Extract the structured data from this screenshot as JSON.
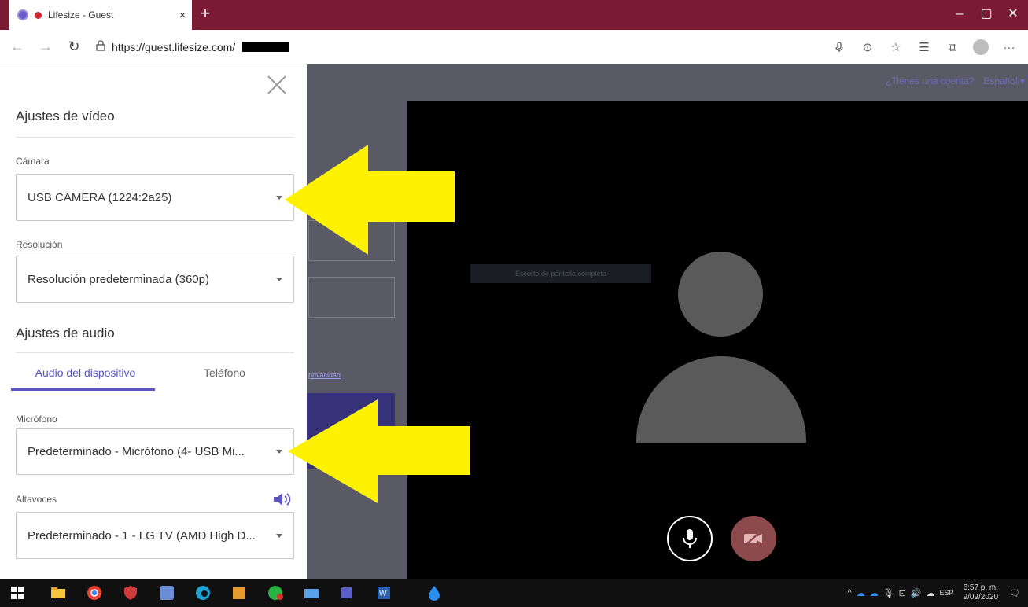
{
  "browser": {
    "tab_title": "Lifesize - Guest",
    "tab_close": "×",
    "new_tab": "+",
    "url": "https://guest.lifesize.com/",
    "minimize": "‒",
    "maximize": "▢",
    "close": "✕",
    "more": "···"
  },
  "page": {
    "account_link": "¿Tienes una cuenta?",
    "language": "Español",
    "fullscreen_tip": "Escorte de pantalla completa",
    "privacy_link": "privacidad"
  },
  "settings": {
    "video_title": "Ajustes de vídeo",
    "camera_label": "Cámara",
    "camera_value": "USB CAMERA (1224:2a25)",
    "resolution_label": "Resolución",
    "resolution_value": "Resolución predeterminada (360p)",
    "audio_title": "Ajustes de audio",
    "tab_device": "Audio del dispositivo",
    "tab_phone": "Teléfono",
    "mic_label": "Micrófono",
    "mic_value": "Predeterminado - Micrófono (4- USB Mi...",
    "speakers_label": "Altavoces",
    "speakers_value": "Predeterminado - 1 - LG TV (AMD High D..."
  },
  "taskbar": {
    "lang": "ESP",
    "time": "6:57 p. m.",
    "date": "9/09/2020"
  },
  "colors": {
    "brand_bar": "#7a1a35",
    "accent": "#5b55c0",
    "arrow": "#fff200",
    "overlay": "#5a5a66"
  }
}
